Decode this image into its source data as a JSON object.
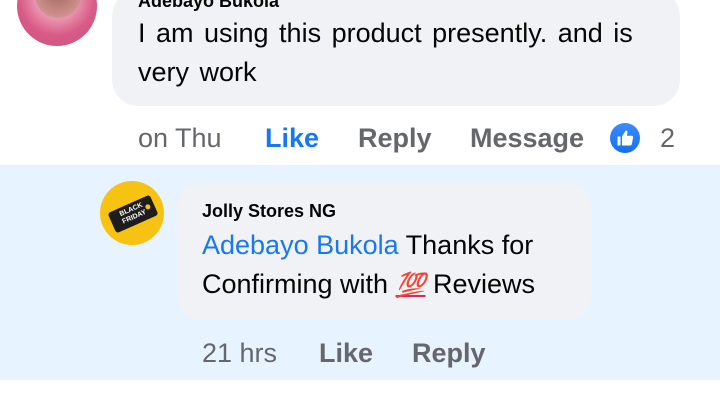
{
  "comment": {
    "author": "Adebayo Bukola",
    "text": "I am using this product presently. and is very  work",
    "time": "on Thu",
    "like_label": "Like",
    "reply_label": "Reply",
    "message_label": "Message",
    "reaction_count": "2",
    "reaction_icon": "thumbs-up-icon"
  },
  "reply": {
    "author": "Jolly Stores NG",
    "avatar_text": "BLACK FRIDAY",
    "mention": "Adebayo Bukola",
    "text_part1": " Thanks for Confirming with ",
    "emoji": "💯",
    "text_part2": " Reviews",
    "time": "21 hrs",
    "like_label": "Like",
    "reply_label": "Reply"
  },
  "colors": {
    "link_blue": "#1877f2",
    "muted": "#65676b",
    "bubble": "#f0f2f5",
    "reply_highlight": "#e7f3ff"
  }
}
